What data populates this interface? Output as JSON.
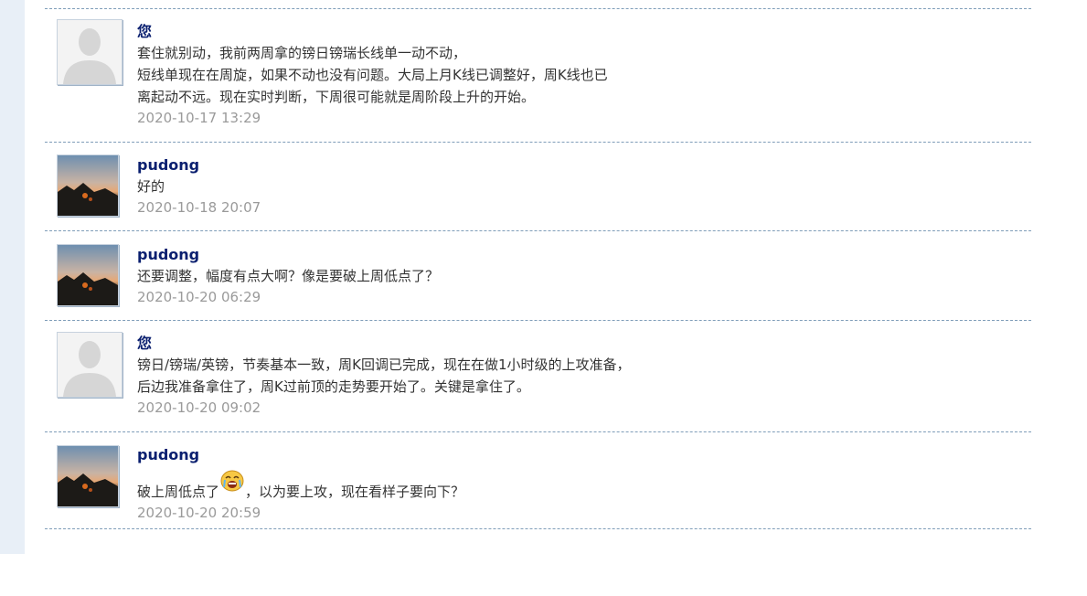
{
  "messages": [
    {
      "author": "您",
      "avatar_icon": "default-user-silhouette-icon",
      "lines": [
        "套住就别动，我前两周拿的镑日镑瑞长线单一动不动，",
        "短线单现在在周旋，如果不动也没有问题。大局上月K线已调整好，周K线也已",
        "离起动不远。现在实时判断，下周很可能就是周阶段上升的开始。"
      ],
      "time": "2020-10-17 13:29"
    },
    {
      "author": "pudong",
      "avatar_icon": "sunset-photo-icon",
      "lines": [
        "好的"
      ],
      "time": "2020-10-18 20:07"
    },
    {
      "author": "pudong",
      "avatar_icon": "sunset-photo-icon",
      "lines": [
        "还要调整，幅度有点大啊？像是要破上周低点了？"
      ],
      "time": "2020-10-20 06:29"
    },
    {
      "author": "您",
      "avatar_icon": "default-user-silhouette-icon",
      "lines": [
        "镑日/镑瑞/英镑，节奏基本一致，周K回调已完成，现在在做1小时级的上攻准备，",
        "后边我准备拿住了，周K过前顶的走势要开始了。关键是拿住了。"
      ],
      "time": "2020-10-20 09:02"
    },
    {
      "author": "pudong",
      "avatar_icon": "sunset-photo-icon",
      "text_before_emoji": "破上周低点了",
      "emoji_icon": "crying-face-emoji-icon",
      "text_after_emoji": "，以为要上攻，现在看样子要向下？",
      "time": "2020-10-20 20:59"
    }
  ],
  "colors": {
    "author": "#0a1f6f",
    "text": "#333333",
    "timestamp": "#9a9a9a",
    "divider": "#7f9db9",
    "left_strip": "#e8eff7"
  }
}
